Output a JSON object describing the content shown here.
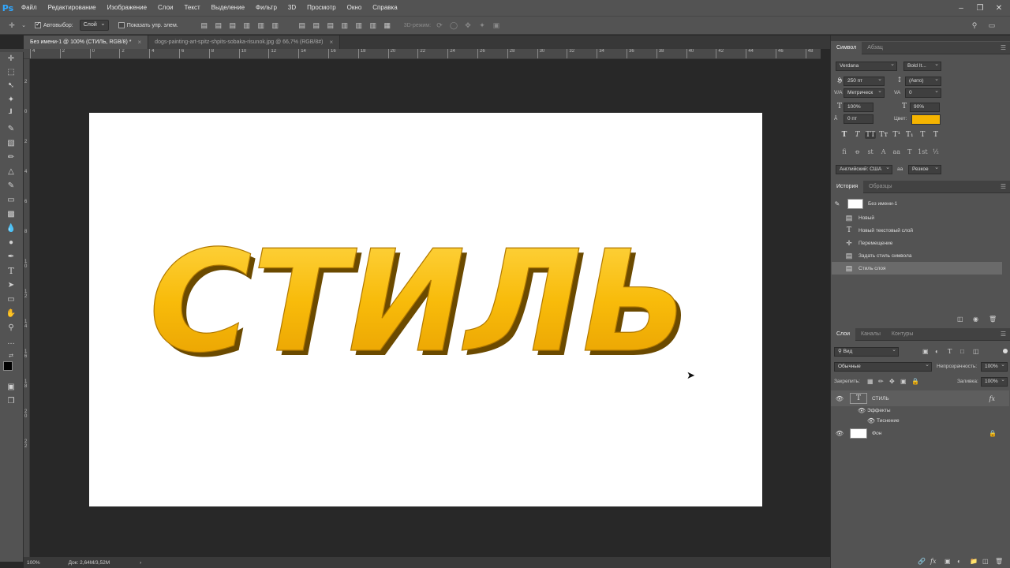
{
  "app": {
    "logo": "Ps",
    "menu": [
      "Файл",
      "Редактирование",
      "Изображение",
      "Слои",
      "Текст",
      "Выделение",
      "Фильтр",
      "3D",
      "Просмотр",
      "Окно",
      "Справка"
    ]
  },
  "options_bar": {
    "autoselect_label": "Автовыбор:",
    "autoselect_checked": true,
    "autoselect_value": "Слой",
    "show_transform_label": "Показать упр. элем.",
    "show_transform_checked": false,
    "mode_3d_label": "3D-режим:"
  },
  "tabs": [
    {
      "label": "Без имени-1 @ 100% (СТИЛЬ, RGB/8) *",
      "active": true
    },
    {
      "label": "dogs-painting-art-spitz-shpits-sobaka-risunok.jpg @ 66,7% (RGB/8#)",
      "active": false
    }
  ],
  "ruler": {
    "top": [
      "4",
      "2",
      "0",
      "2",
      "4",
      "6",
      "8",
      "10",
      "12",
      "14",
      "16",
      "18",
      "20",
      "22",
      "24",
      "26",
      "28",
      "30",
      "32",
      "34",
      "36",
      "38",
      "40",
      "42",
      "44",
      "46",
      "48"
    ],
    "left": [
      "2",
      "0",
      "2",
      "4",
      "6",
      "8",
      "1\n0",
      "1\n2",
      "1\n4",
      "1\n6",
      "1\n8",
      "2\n0",
      "2\n2"
    ]
  },
  "canvas": {
    "text": "СТИЛЬ",
    "text_color": "#f5b400",
    "background": "#ffffff"
  },
  "status": {
    "zoom": "100%",
    "doc_size": "Док: 2,64M/3,52M",
    "arrow": "›"
  },
  "character_panel": {
    "tabs": [
      "Символ",
      "Абзац"
    ],
    "font_family": "Verdana",
    "font_style": "Bold It...",
    "size": "250 пт",
    "leading": "(Авто)",
    "kerning": "Метрическ",
    "tracking": "0",
    "vscale": "100%",
    "hscale": "90%",
    "baseline": "0 пт",
    "color_label": "Цвет:",
    "color": "#f5b400",
    "style_buttons": [
      "T",
      "T",
      "TT",
      "Tт",
      "T¹",
      "T₁",
      "T",
      "T"
    ],
    "opentype_buttons": [
      "fi",
      "ꝋ",
      "st",
      "A",
      "aa",
      "T",
      "1st",
      "½"
    ],
    "language": "Английский: США",
    "antialias_icon": "aa",
    "antialias": "Резкое"
  },
  "history_panel": {
    "tabs": [
      "История",
      "Образцы"
    ],
    "snapshot": "Без имени-1",
    "items": [
      {
        "label": "Новый",
        "icon": "doc-icon"
      },
      {
        "label": "Новый текстовый слой",
        "icon": "type-icon"
      },
      {
        "label": "Перемещение",
        "icon": "move-icon"
      },
      {
        "label": "Задать стиль символа",
        "icon": "doc-icon"
      },
      {
        "label": "Стиль слоя",
        "icon": "doc-icon",
        "selected": true
      }
    ]
  },
  "layers_panel": {
    "tabs": [
      "Слои",
      "Каналы",
      "Контуры"
    ],
    "filter_kind": "Вид",
    "blend_mode": "Обычные",
    "opacity_label": "Непрозрачность:",
    "opacity": "100%",
    "lock_label": "Закрепить:",
    "fill_label": "Заливка:",
    "fill": "100%",
    "layers": [
      {
        "name": "СТИЛЬ",
        "type": "text",
        "fx": "fx"
      },
      {
        "name": "Эффекты",
        "type": "effects"
      },
      {
        "name": "Тиснение",
        "type": "effect"
      },
      {
        "name": "Фон",
        "type": "background",
        "locked": true
      }
    ],
    "bottom_icons": [
      "link-icon",
      "fx-icon",
      "mask-icon",
      "adjustment-icon",
      "group-icon",
      "new-layer-icon",
      "trash-icon"
    ]
  }
}
